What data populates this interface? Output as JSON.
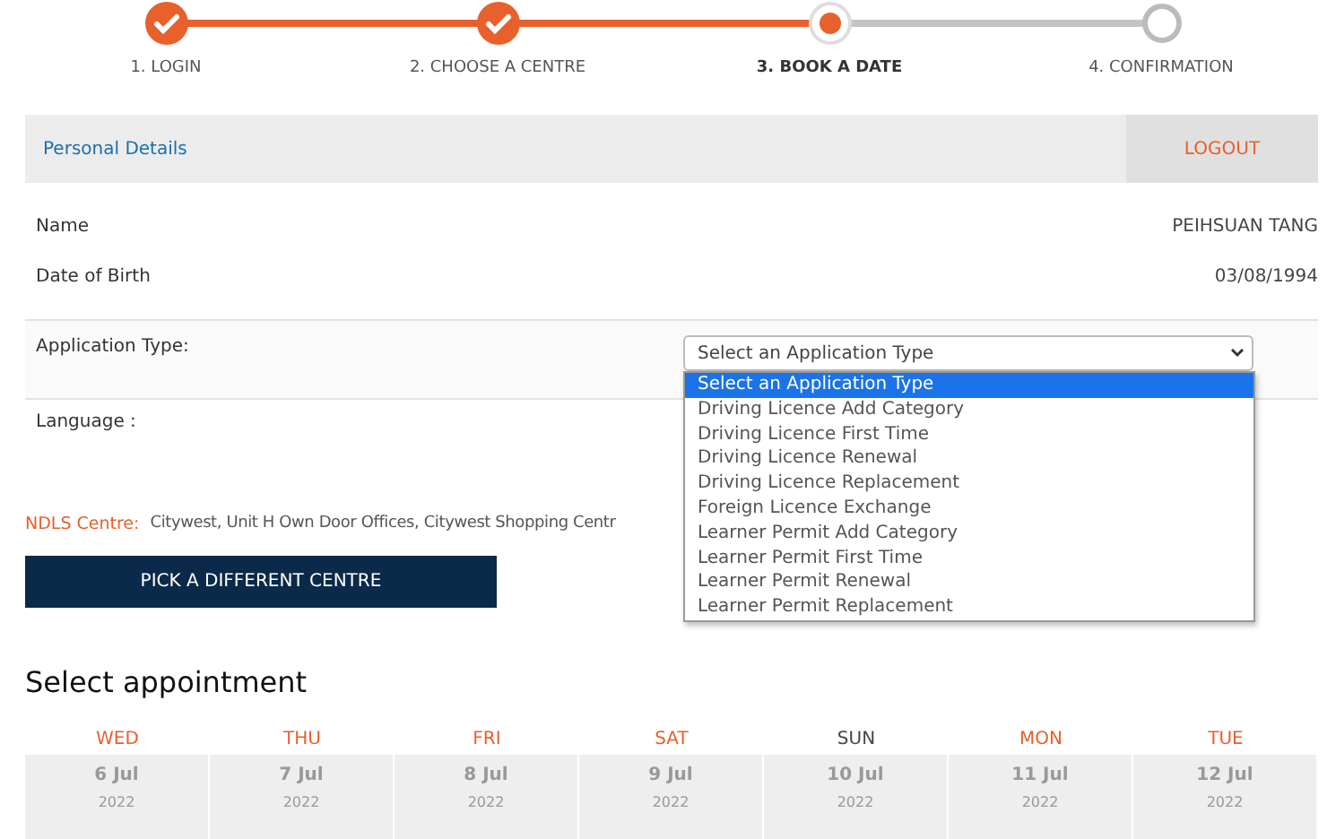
{
  "steps": [
    {
      "label": "1. LOGIN",
      "kind": "done"
    },
    {
      "label": "2. CHOOSE A CENTRE",
      "kind": "done"
    },
    {
      "label": "3. BOOK A DATE",
      "kind": "current"
    },
    {
      "label": "4. CONFIRMATION",
      "kind": "pending"
    }
  ],
  "personal_details": {
    "title": "Personal Details",
    "logout": "LOGOUT",
    "fields": [
      {
        "label": "Name",
        "value": "PEIHSUAN TANG"
      },
      {
        "label": "Date of Birth",
        "value": "03/08/1994"
      }
    ]
  },
  "application_type": {
    "label": "Application Type:",
    "value": "Select an Application Type",
    "expanded": true,
    "options": [
      {
        "label": "Select an Application Type",
        "selected": true
      },
      {
        "label": "Driving Licence Add Category",
        "selected": false
      },
      {
        "label": "Driving Licence First Time",
        "selected": false
      },
      {
        "label": "Driving Licence Renewal",
        "selected": false
      },
      {
        "label": "Driving Licence Replacement",
        "selected": false
      },
      {
        "label": "Foreign Licence Exchange",
        "selected": false
      },
      {
        "label": "Learner Permit Add Category",
        "selected": false
      },
      {
        "label": "Learner Permit First Time",
        "selected": false
      },
      {
        "label": "Learner Permit Renewal",
        "selected": false
      },
      {
        "label": "Learner Permit Replacement",
        "selected": false
      }
    ]
  },
  "language": {
    "label": "Language :"
  },
  "centre": {
    "label": "NDLS Centre:",
    "value": "Citywest, Unit H Own Door Offices, Citywest Shopping Centr"
  },
  "pick_button": "PICK A DIFFERENT CENTRE",
  "appointments": {
    "title": "Select appointment",
    "days": [
      {
        "weekday": "WED",
        "date": "6 Jul",
        "year": "2022",
        "closed": false
      },
      {
        "weekday": "THU",
        "date": "7 Jul",
        "year": "2022",
        "closed": false
      },
      {
        "weekday": "FRI",
        "date": "8 Jul",
        "year": "2022",
        "closed": false
      },
      {
        "weekday": "SAT",
        "date": "9 Jul",
        "year": "2022",
        "closed": false
      },
      {
        "weekday": "SUN",
        "date": "10 Jul",
        "year": "2022",
        "closed": true
      },
      {
        "weekday": "MON",
        "date": "11 Jul",
        "year": "2022",
        "closed": false
      },
      {
        "weekday": "TUE",
        "date": "12 Jul",
        "year": "2022",
        "closed": false
      }
    ]
  }
}
